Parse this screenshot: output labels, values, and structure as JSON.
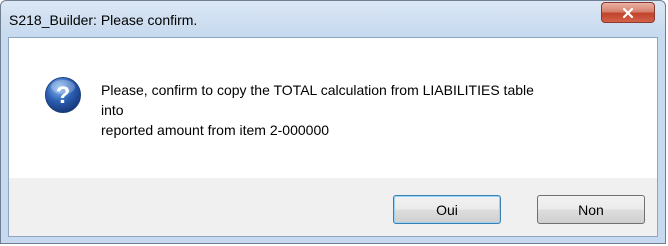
{
  "window": {
    "title": "S218_Builder: Please confirm."
  },
  "dialog": {
    "icon": "question-icon",
    "message": "Please, confirm to copy the TOTAL calculation from LIABILITIES table\ninto\nreported amount from item 2-000000"
  },
  "buttons": {
    "oui_label": "Oui",
    "non_label": "Non"
  },
  "colors": {
    "titlebar": "#c9dbef",
    "close_button": "#c0432a",
    "button_face": "#e6e6e6",
    "default_button_border": "#3c7fb1",
    "icon_blue": "#2c5fb3"
  }
}
